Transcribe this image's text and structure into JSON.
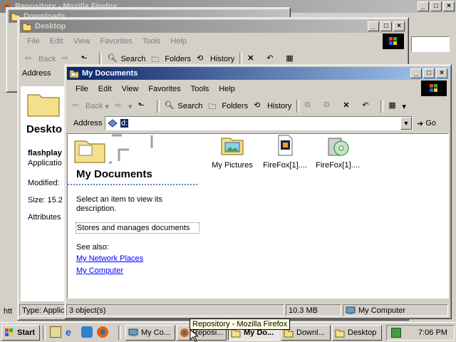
{
  "windows": {
    "firefox_title": "Repository - Mozilla Firefox",
    "downloads_title": "Downloads",
    "desktop": {
      "title": "Desktop",
      "menu": [
        "File",
        "Edit",
        "View",
        "Favorites",
        "Tools",
        "Help"
      ],
      "toolbar": {
        "back": "Back",
        "search": "Search",
        "folders": "Folders",
        "history": "History"
      },
      "address_label": "Address",
      "left_heading": "Deskto",
      "file_name": "flashplay",
      "file_type": "Applicatio",
      "modified": "Modified:",
      "size": "Size: 15.2",
      "attributes": "Attributes",
      "status_type": "Type: Applic"
    },
    "mydocs": {
      "title": "My Documents",
      "menu": [
        "File",
        "Edit",
        "View",
        "Favorites",
        "Tools",
        "Help"
      ],
      "toolbar": {
        "back": "Back",
        "search": "Search",
        "folders": "Folders",
        "history": "History"
      },
      "address_label": "Address",
      "address_value": "d:",
      "go_label": "Go",
      "panel": {
        "heading": "My Documents",
        "select_hint": "Select an item to view its description.",
        "description": "Stores and manages documents",
        "see_also": "See also:",
        "links": [
          "My Network Places",
          "My Computer"
        ]
      },
      "files": [
        {
          "name": "My Pictures",
          "icon": "folder-pictures-icon"
        },
        {
          "name": "FireFox[1]....",
          "icon": "media-file-icon"
        },
        {
          "name": "FireFox[1]....",
          "icon": "cd-installer-icon"
        }
      ],
      "status": {
        "objects": "3 object(s)",
        "size": "10.3 MB",
        "zone": "My Computer"
      }
    }
  },
  "tooltip": "Repository - Mozilla Firefox",
  "taskbar": {
    "start": "Start",
    "buttons": [
      {
        "label": "My Co...",
        "icon": "computer-icon"
      },
      {
        "label": "Reposi...",
        "icon": "firefox-icon"
      },
      {
        "label": "My Do...",
        "icon": "folder-icon",
        "active": true
      },
      {
        "label": "Downl...",
        "icon": "folder-icon"
      },
      {
        "label": "Desktop",
        "icon": "folder-icon"
      }
    ],
    "clock": "7:06 PM"
  },
  "colors": {
    "desktop": "#3a6ea5",
    "titlebar_active": "#0a246a",
    "face": "#d4d0c8",
    "link": "#0000ff"
  }
}
